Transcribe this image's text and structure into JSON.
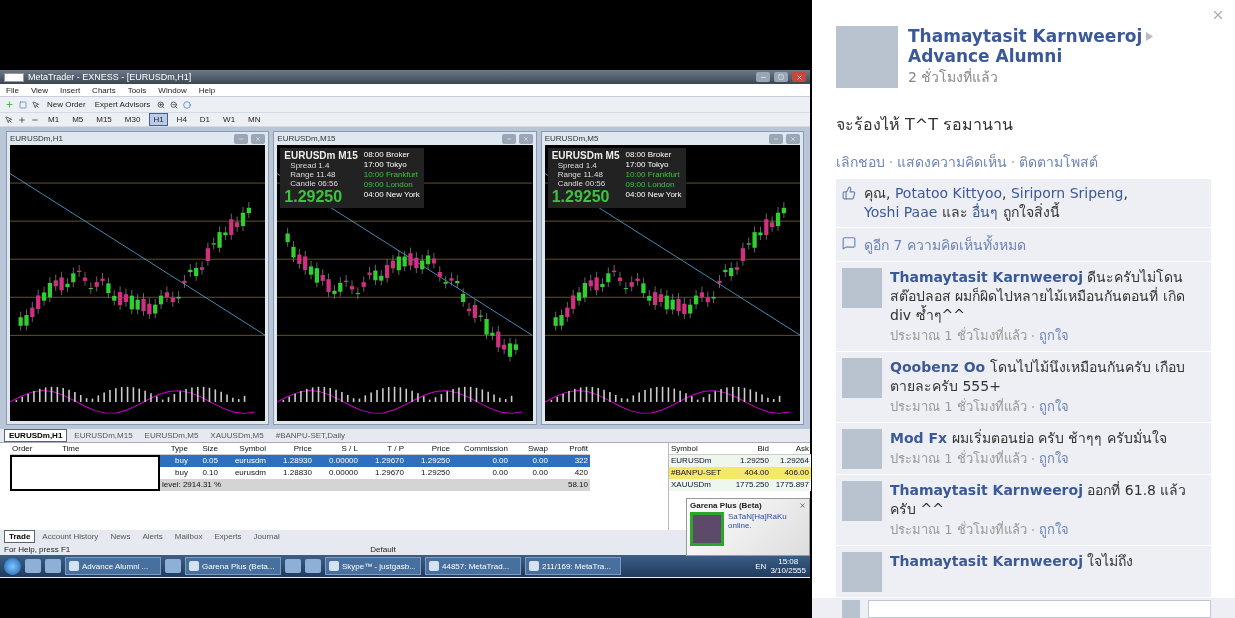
{
  "screenshot": {
    "window": {
      "title": "MetaTrader - EXNESS - [EURUSDm,H1]"
    },
    "menu": [
      "File",
      "View",
      "Insert",
      "Charts",
      "Tools",
      "Window",
      "Help"
    ],
    "toolbar": {
      "buttons": [
        "New Order",
        "Expert Advisors"
      ],
      "timeframes": [
        {
          "label": "M1",
          "selected": false
        },
        {
          "label": "M5",
          "selected": false
        },
        {
          "label": "M15",
          "selected": false
        },
        {
          "label": "M30",
          "selected": false
        },
        {
          "label": "H1",
          "selected": true
        },
        {
          "label": "H4",
          "selected": false
        },
        {
          "label": "D1",
          "selected": false
        },
        {
          "label": "W1",
          "selected": false
        },
        {
          "label": "MN",
          "selected": false
        }
      ]
    },
    "charts": [
      {
        "title": "EURUSDm,H1"
      },
      {
        "title": "EURUSDm,M15",
        "info": {
          "symbol": "EURUSDm",
          "timeframe": "M15",
          "rows": [
            {
              "label": "Spread",
              "value": "1.4"
            },
            {
              "label": "Range",
              "value": "11.48"
            },
            {
              "label": "Candle",
              "value": "06:56"
            }
          ],
          "price": "1.29250",
          "sessions": [
            {
              "time": "08:00",
              "label": "Broker",
              "active": false
            },
            {
              "time": "17:00",
              "label": "Tokyo",
              "active": false
            },
            {
              "time": "10:00",
              "label": "Frankfurt",
              "active": true
            },
            {
              "time": "09:00",
              "label": "London",
              "active": true
            },
            {
              "time": "04:00",
              "label": "New York",
              "active": false
            }
          ]
        }
      },
      {
        "title": "EURUSDm,M5",
        "info": {
          "symbol": "EURUSDm",
          "timeframe": "M5",
          "rows": [
            {
              "label": "Spread",
              "value": "1.4"
            },
            {
              "label": "Range",
              "value": "11.48"
            },
            {
              "label": "Candle",
              "value": "00:56"
            }
          ],
          "price": "1.29250",
          "sessions": [
            {
              "time": "08:00",
              "label": "Broker",
              "active": false
            },
            {
              "time": "17:00",
              "label": "Tokyo",
              "active": false
            },
            {
              "time": "10:00",
              "label": "Frankfurt",
              "active": true
            },
            {
              "time": "09:00",
              "label": "London",
              "active": true
            },
            {
              "time": "04:00",
              "label": "New York",
              "active": false
            }
          ]
        }
      }
    ],
    "chart_tabs": [
      {
        "label": "EURUSDm,H1",
        "selected": true
      },
      {
        "label": "EURUSDm,M15",
        "selected": false
      },
      {
        "label": "EURUSDm,M5",
        "selected": false
      },
      {
        "label": "XAUUSDm,M5",
        "selected": false
      },
      {
        "label": "#BANPU-SET,Daily",
        "selected": false
      }
    ],
    "trade_table": {
      "columns": [
        "Order",
        "Time",
        "Type",
        "Size",
        "Symbol",
        "Price",
        "S / L",
        "T / P",
        "Price",
        "Commission",
        "Swap",
        "Profit"
      ],
      "rows": [
        {
          "selected": true,
          "cells": [
            "",
            "",
            "buy",
            "0.05",
            "eurusdm",
            "1.28930",
            "0.00000",
            "1.29670",
            "1.29250",
            "0.00",
            "0.00",
            "322"
          ]
        },
        {
          "selected": false,
          "cells": [
            "",
            "",
            "buy",
            "0.10",
            "eurusdm",
            "1.28830",
            "0.00000",
            "1.29670",
            "1.29250",
            "0.00",
            "0.00",
            "420"
          ]
        }
      ],
      "summary": {
        "label": "level: 2914.31 %",
        "profit": "58.10"
      }
    },
    "market_watch": {
      "columns": [
        "Symbol",
        "Bid",
        "Ask"
      ],
      "rows": [
        {
          "highlighted": false,
          "cells": [
            "EURUSDm",
            "1.29250",
            "1.29264"
          ]
        },
        {
          "highlighted": true,
          "cells": [
            "#BANPU-SET",
            "404.00",
            "406.00"
          ]
        },
        {
          "highlighted": false,
          "cells": [
            "XAUUSDm",
            "1775.250",
            "1775.897"
          ]
        }
      ]
    },
    "terminal_tabs": [
      {
        "label": "Trade",
        "selected": true
      },
      {
        "label": "Account History",
        "selected": false
      },
      {
        "label": "News",
        "selected": false
      },
      {
        "label": "Alerts",
        "selected": false
      },
      {
        "label": "Mailbox",
        "selected": false
      },
      {
        "label": "Experts",
        "selected": false
      },
      {
        "label": "Journal",
        "selected": false
      }
    ],
    "status_bar": [
      "For Help, press F1",
      "Default"
    ],
    "notification": {
      "title": "Garena Plus (Beta)",
      "message": "SaTaN[Ha]RaKu online."
    },
    "taskbar": {
      "items": [
        {
          "kind": "icon"
        },
        {
          "kind": "icon"
        },
        {
          "kind": "window",
          "label": "Advance Alumni ..."
        },
        {
          "kind": "icon"
        },
        {
          "kind": "window",
          "label": "Garena Plus (Beta..."
        },
        {
          "kind": "icon"
        },
        {
          "kind": "icon"
        },
        {
          "kind": "window",
          "label": "Skype™ - justgasb..."
        },
        {
          "kind": "window",
          "label": "44857: MetaTrad..."
        },
        {
          "kind": "window",
          "label": "211/169: MetaTra..."
        }
      ],
      "language": "EN",
      "time": "15:08",
      "date": "3/10/2555"
    }
  },
  "post": {
    "author": "Thamaytasit Karnweeroj",
    "group": "Advance Alumni",
    "time": "2 ชั่วโมงที่แล้ว",
    "text": "จะร้องไห้ T^T รอมานาน",
    "actions": [
      "เลิกชอบ",
      "แสดงความคิดเห็น",
      "ติดตามโพสต์"
    ],
    "likes": [
      {
        "text": "คุณ",
        "link": false
      },
      {
        "text": ", ",
        "link": false
      },
      {
        "text": "Potatoo Kittyoo",
        "link": true
      },
      {
        "text": ", ",
        "link": false
      },
      {
        "text": "Siriporn Sripeng",
        "link": true
      },
      {
        "text": ", ",
        "link": false
      },
      {
        "text": "Yoshi Paae",
        "link": true
      },
      {
        "text": " และ ",
        "link": false
      },
      {
        "text": "อื่นๆ",
        "link": true
      },
      {
        "text": " ถูกใจสิ่งนี้",
        "link": false
      }
    ],
    "more_comments": "ดูอีก 7 ความคิดเห็นทั้งหมด",
    "comments": [
      {
        "author": "Thamaytasit Karnweeroj",
        "text": "ดีนะครับไม่โดนสต๊อปลอส ผมก็ผิดไปหลายไม้เหมือนกันตอนที่ เกิด div ซ้ำๆ^^",
        "time": "ประมาณ 1 ชั่วโมงที่แล้ว",
        "like": "ถูกใจ"
      },
      {
        "author": "Qoobenz Oo",
        "text": "โดนไปไม้นึงเหมือนกันครับ เกือบตายละครับ 555+",
        "time": "ประมาณ 1 ชั่วโมงที่แล้ว",
        "like": "ถูกใจ"
      },
      {
        "author": "Mod Fx",
        "text": "ผมเริ่มตอนย่อ ครับ ช้าๆๆ ครับมั่นใจ",
        "time": "ประมาณ 1 ชั่วโมงที่แล้ว",
        "like": "ถูกใจ"
      },
      {
        "author": "Thamaytasit Karnweeroj",
        "text": "ออกที่ 61.8 แล้วครับ ^^",
        "time": "ประมาณ 1 ชั่วโมงที่แล้ว",
        "like": "ถูกใจ"
      },
      {
        "author": "Thamaytasit Karnweeroj",
        "text": "ใจไม่ถึง"
      }
    ]
  }
}
